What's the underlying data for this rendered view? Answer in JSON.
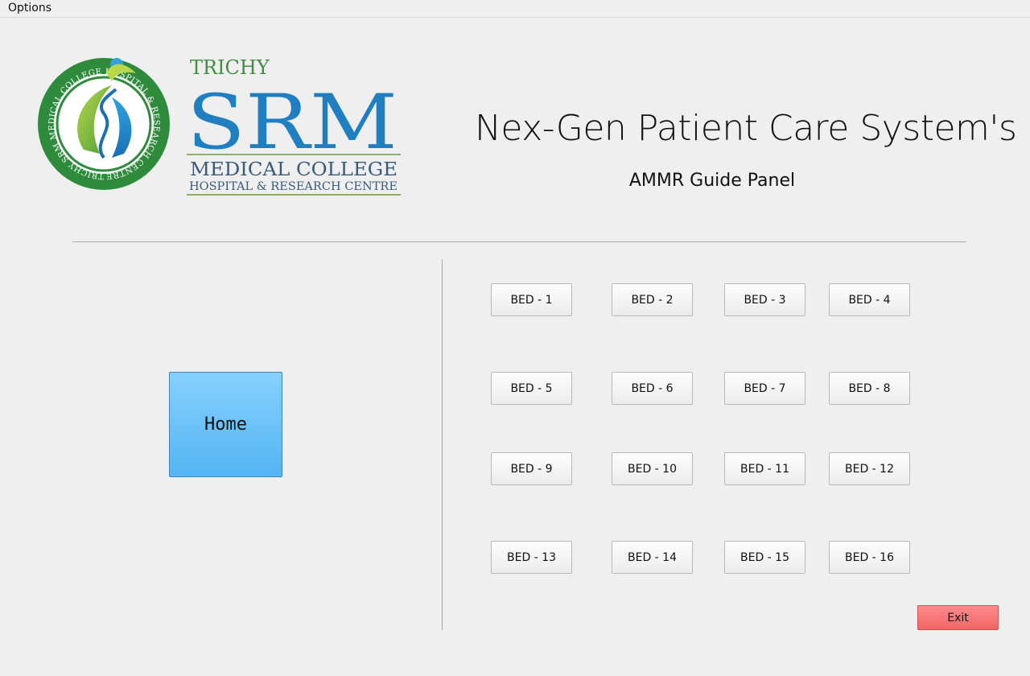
{
  "menubar": {
    "options_label": "Options"
  },
  "logo": {
    "ring_text": "TRICHY SRM MEDICAL COLLEGE HOSPITAL & RESEARCH CENTRE",
    "line_trichy": "TRICHY",
    "line_srm": "SRM",
    "line_medical": "MEDICAL COLLEGE",
    "line_hospital": "HOSPITAL & RESEARCH CENTRE"
  },
  "header": {
    "title": "Nex-Gen Patient Care System's",
    "subtitle": "AMMR Guide Panel"
  },
  "home_label": "Home",
  "beds": [
    "BED - 1",
    "BED - 2",
    "BED - 3",
    "BED - 4",
    "BED - 5",
    "BED - 6",
    "BED - 7",
    "BED - 8",
    "BED - 9",
    "BED - 10",
    "BED - 11",
    "BED - 12",
    "BED - 13",
    "BED - 14",
    "BED - 15",
    "BED - 16"
  ],
  "exit_label": "Exit",
  "colors": {
    "home_button": "#5bb8f4",
    "exit_button": "#f27070",
    "logo_green": "#3f8f3f",
    "logo_blue": "#1f7fc0"
  }
}
